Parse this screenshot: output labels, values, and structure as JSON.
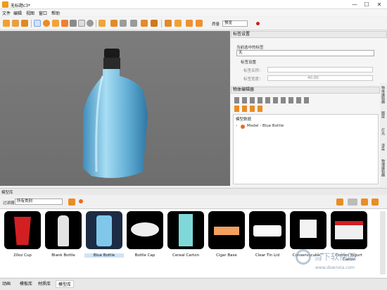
{
  "window": {
    "title": "无标题c3*",
    "min": "—",
    "max": "☐",
    "close": "✕"
  },
  "menu": [
    "文件",
    "编辑",
    "视图",
    "窗口",
    "帮助"
  ],
  "toolbar": {
    "quality_label": "质量",
    "quality_value": "预览"
  },
  "tag_panel": {
    "title": "标签设置",
    "current_label": "当前选中的标签",
    "current_value": "无",
    "section": "标签设置",
    "name_label": "标签名称：",
    "width_label": "标签宽度：",
    "width_value": "40.00"
  },
  "obj_panel": {
    "title": "物体编辑器",
    "tree_root": "模型数据",
    "tree_item": "Model - Blue Bottle"
  },
  "right_tabs": [
    "物体编辑器",
    "图层",
    "灯光",
    "渲染",
    "物理编辑器"
  ],
  "library": {
    "title": "模型库",
    "filter_label": "过滤器",
    "filter_value": "所有类别",
    "items": [
      "20oz Cup",
      "Blank Bottle",
      "Blue Bottle",
      "Bottle Cap",
      "Cereal Carton",
      "Cigar Base",
      "Clear Tin Lid",
      "Conservacube™",
      "Corner Yogurt Carton"
    ]
  },
  "bottom_tabs": [
    "动画",
    "模板库",
    "材质库",
    "模型库"
  ],
  "watermark": {
    "cn": "当下软件园",
    "url": "www.downxia.com"
  }
}
